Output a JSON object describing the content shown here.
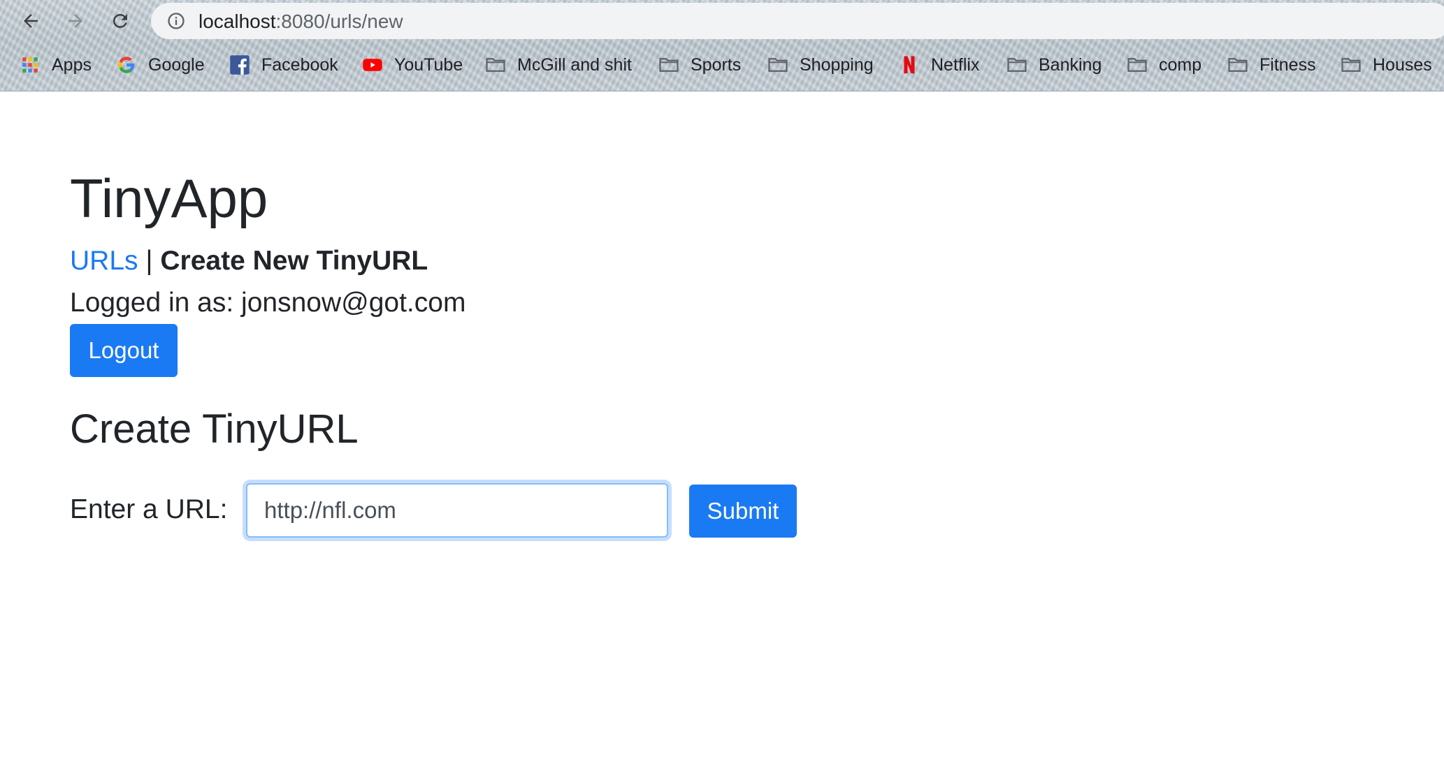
{
  "browser": {
    "url_host": "localhost",
    "url_rest": ":8080/urls/new",
    "bookmarks": [
      {
        "label": "Apps",
        "icon": "apps-grid-icon"
      },
      {
        "label": "Google",
        "icon": "google-icon"
      },
      {
        "label": "Facebook",
        "icon": "facebook-icon"
      },
      {
        "label": "YouTube",
        "icon": "youtube-icon"
      },
      {
        "label": "McGill and shit",
        "icon": "folder-icon"
      },
      {
        "label": "Sports",
        "icon": "folder-icon"
      },
      {
        "label": "Shopping",
        "icon": "folder-icon"
      },
      {
        "label": "Netflix",
        "icon": "netflix-icon"
      },
      {
        "label": "Banking",
        "icon": "folder-icon"
      },
      {
        "label": "comp",
        "icon": "folder-icon"
      },
      {
        "label": "Fitness",
        "icon": "folder-icon"
      },
      {
        "label": "Houses",
        "icon": "folder-icon"
      }
    ]
  },
  "page": {
    "title": "TinyApp",
    "nav": {
      "urls_link": "URLs",
      "separator": "|",
      "current": "Create New TinyURL"
    },
    "logged_in_text": "Logged in as: jonsnow@got.com",
    "logout_label": "Logout",
    "section_title": "Create TinyURL",
    "url_label": "Enter a URL:",
    "url_value": "http://nfl.com",
    "submit_label": "Submit"
  },
  "colors": {
    "primary": "#1a7af3",
    "text": "#212529",
    "focus_border": "#80bdff"
  }
}
